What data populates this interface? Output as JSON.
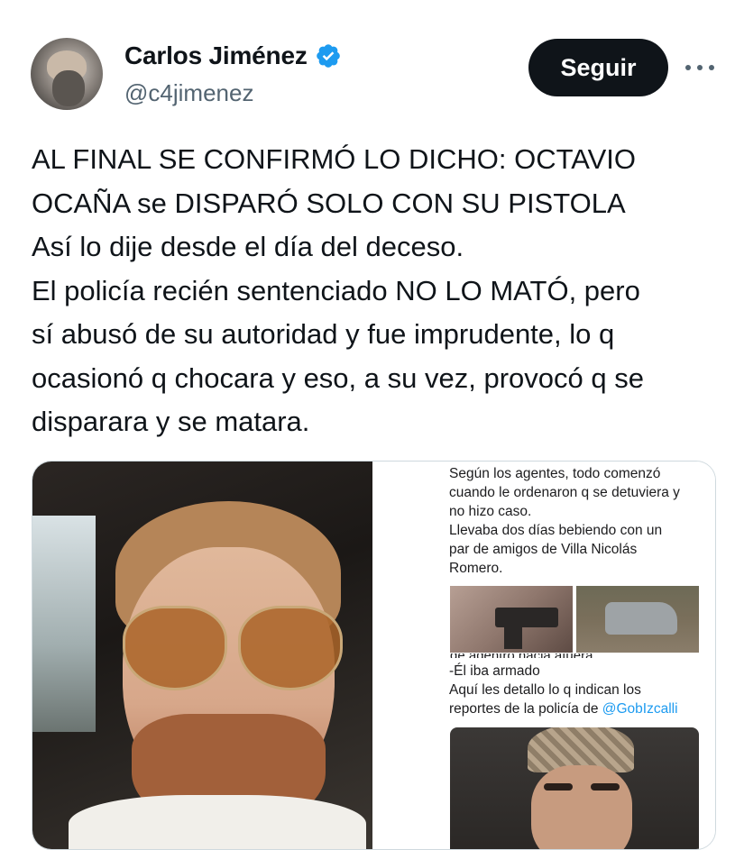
{
  "author": {
    "display_name": "Carlos Jiménez",
    "handle": "@c4jimenez",
    "verified": true
  },
  "actions": {
    "follow_label": "Seguir"
  },
  "tweet": {
    "lines": [
      "AL FINAL SE CONFIRMÓ LO DICHO: OCTAVIO",
      "OCAÑA se DISPARÓ SOLO CON SU PISTOLA",
      "Así lo dije desde el día del deceso.",
      "El policía recién sentenciado NO LO MATÓ, pero",
      "sí abusó de su autoridad y fue imprudente, lo q",
      "ocasionó q chocara y eso, a su vez, provocó q se",
      "disparara y se matara."
    ]
  },
  "screenshot_panel": {
    "top_lines": [
      "Según los agentes, todo comenzó",
      "cuando le ordenaron q se detuviera y",
      "no hizo caso.",
      "Llevaba dos días bebiendo con un",
      "par de amigos de Villa Nicolás",
      "Romero."
    ],
    "cut_line": "de adentro hacia afuera",
    "bottom_lines": [
      "-Él iba armado",
      "Aquí les detallo lo q indican los"
    ],
    "last_line_prefix": "reportes de la policía de ",
    "mention": "@GobIzcalli"
  },
  "colors": {
    "accent": "#1d9bf0",
    "text": "#0f1419",
    "secondary_text": "#536471",
    "follow_button_bg": "#0f1419"
  },
  "icons": {
    "verified": "verified-badge-icon",
    "more": "more-options-icon"
  }
}
